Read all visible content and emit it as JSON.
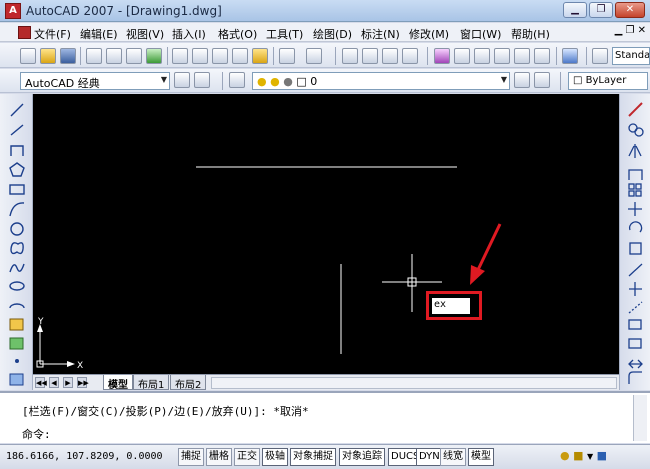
{
  "window": {
    "title": "AutoCAD 2007 - [Drawing1.dwg]",
    "app_icon_letter": "A"
  },
  "menu": {
    "items": [
      "文件(F)",
      "编辑(E)",
      "视图(V)",
      "插入(I)",
      "格式(O)",
      "工具(T)",
      "绘图(D)",
      "标注(N)",
      "修改(M)",
      "窗口(W)",
      "帮助(H)"
    ]
  },
  "toolbar2": {
    "workspace": "AutoCAD 经典",
    "layer": "0",
    "color": "ByLayer"
  },
  "toolbar1": {
    "style": "Standa"
  },
  "canvas": {
    "background": "#000000",
    "command_input": "ex",
    "highlight_color": "#e01a22",
    "arrow_color": "#e01a22",
    "ucs_x_label": "X",
    "ucs_y_label": "Y"
  },
  "tabs": {
    "model": "模型",
    "layout1": "布局1",
    "layout2": "布局2",
    "nav": [
      "◀◀",
      "◀",
      "▶",
      "▶▶"
    ]
  },
  "command": {
    "history": "[栏选(F)/窗交(C)/投影(P)/边(E)/放弃(U)]:  *取消*",
    "prompt": "命令:"
  },
  "status": {
    "coords": "186.6166,  107.8209, 0.0000",
    "buttons": [
      "捕捉",
      "栅格",
      "正交",
      "极轴",
      "对象捕捉",
      "对象追踪",
      "DUCS",
      "DYN",
      "线宽",
      "模型"
    ]
  }
}
